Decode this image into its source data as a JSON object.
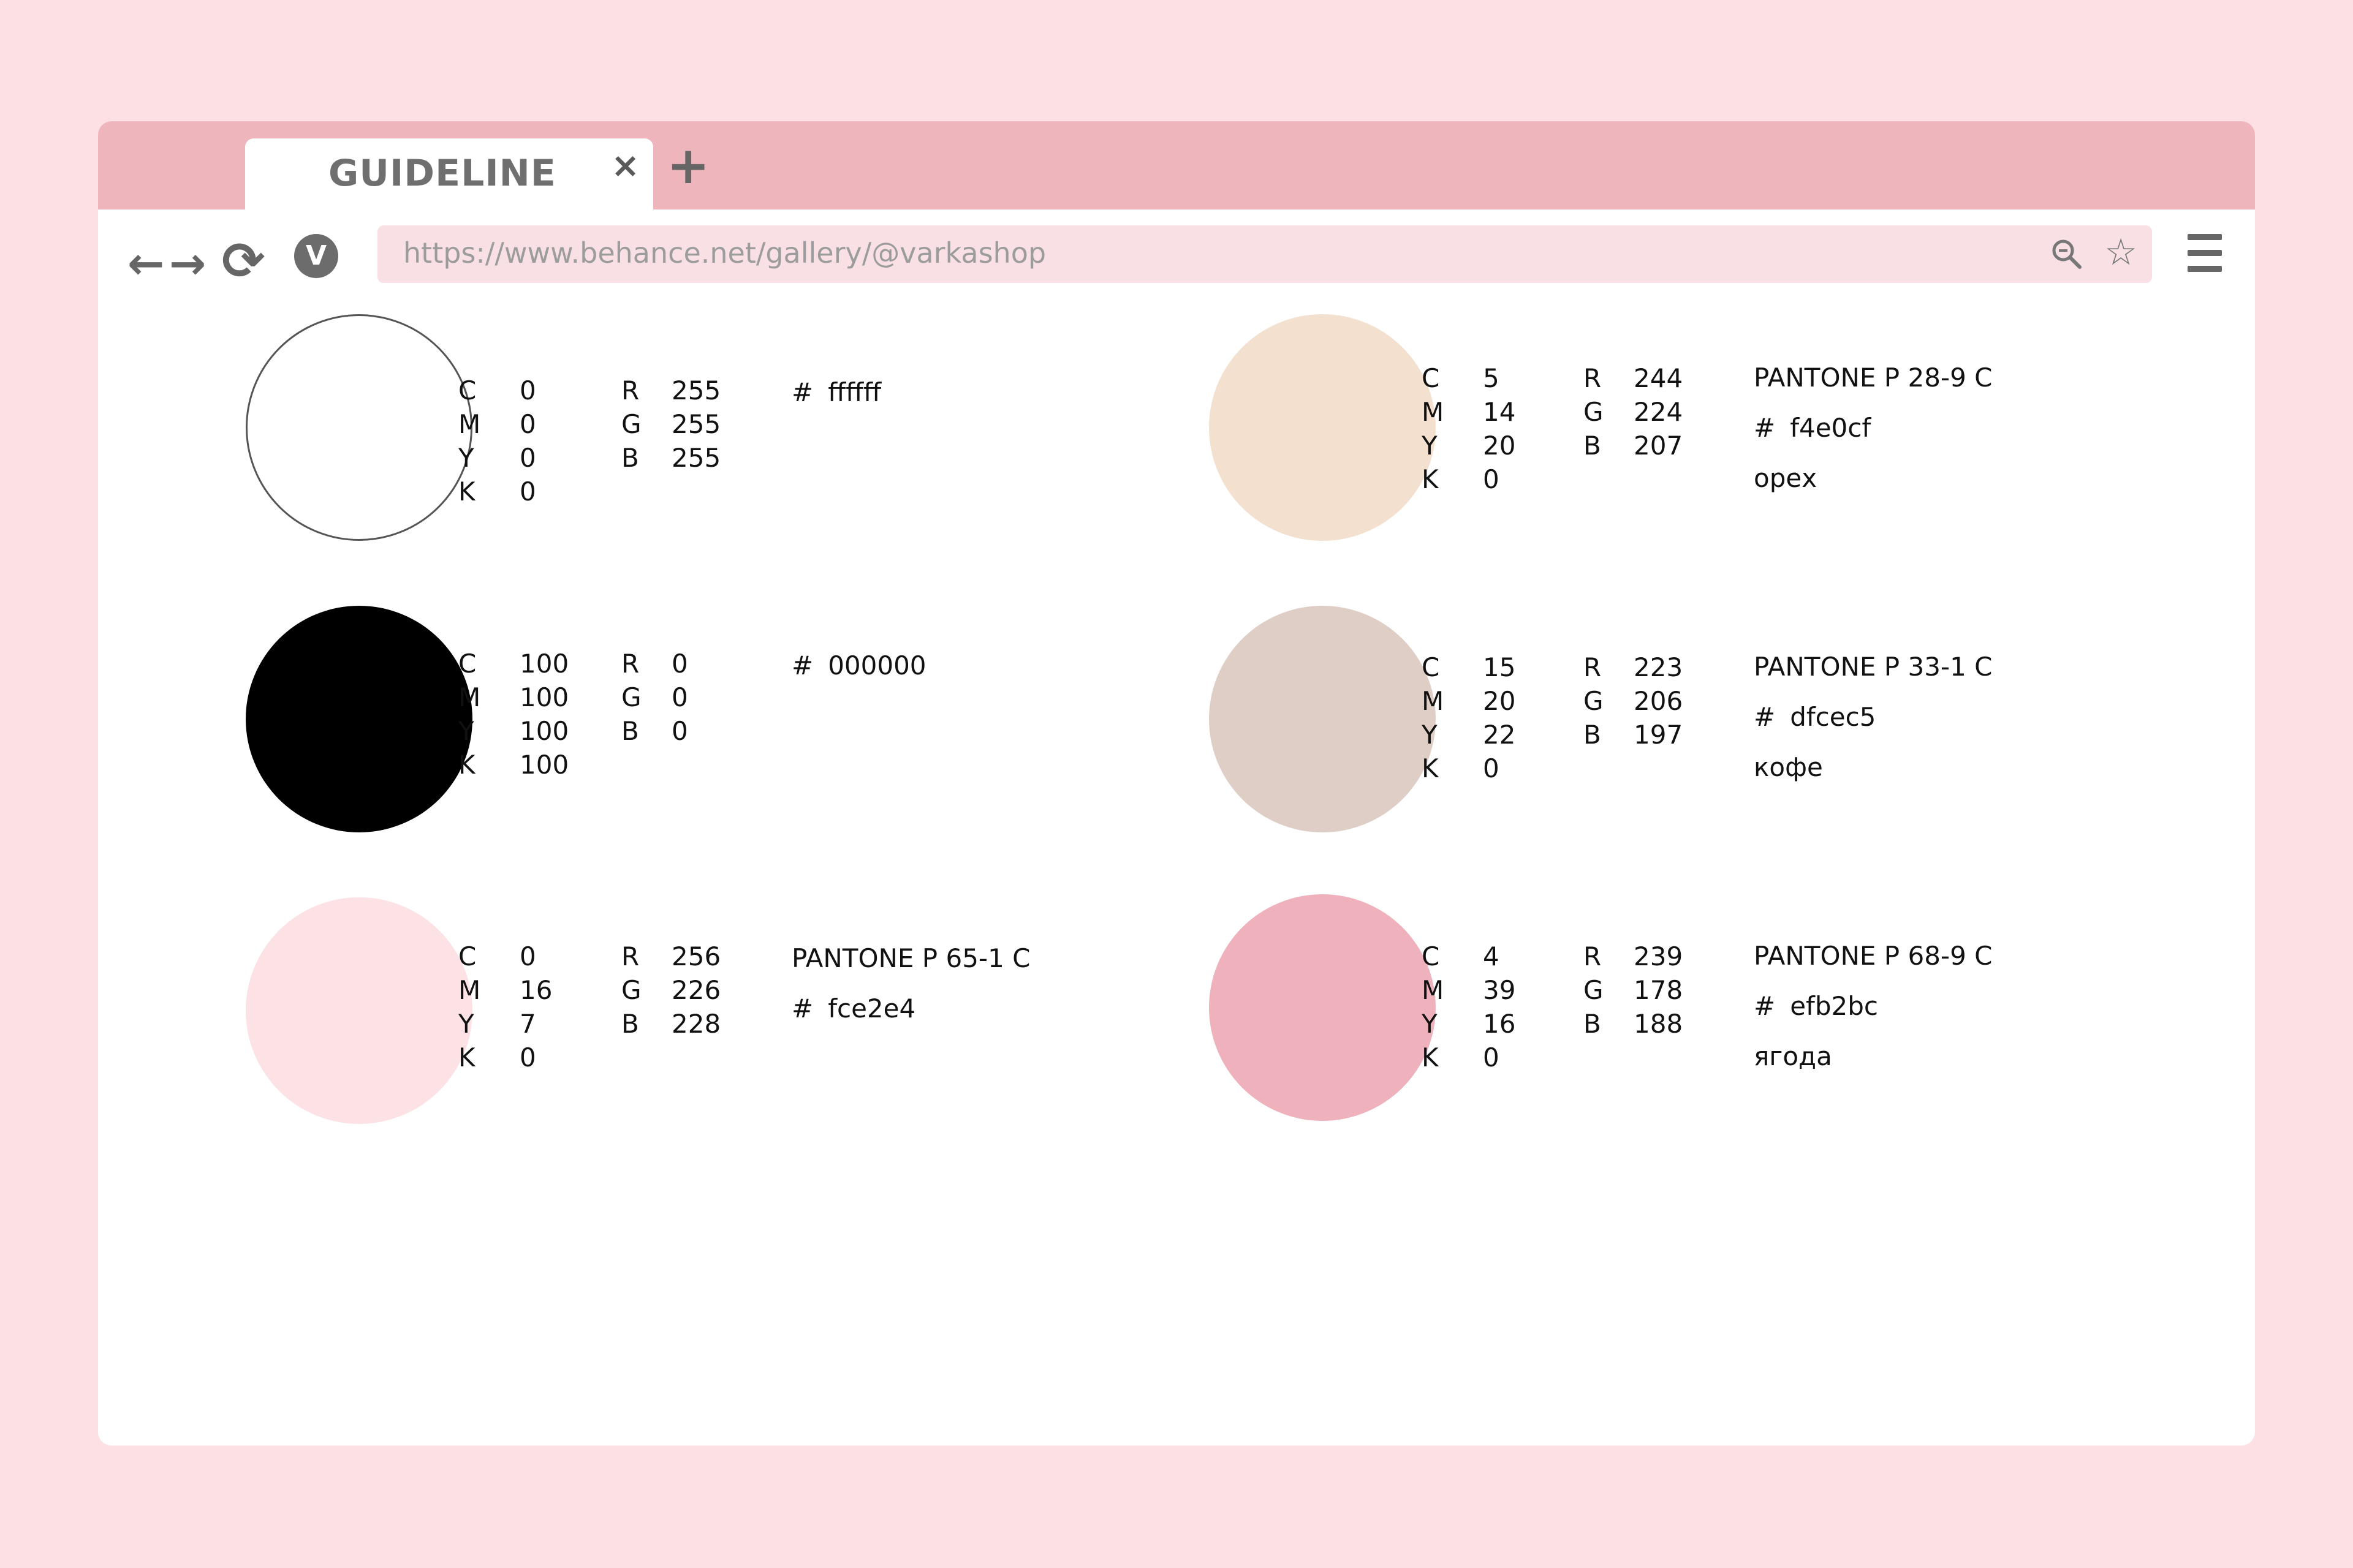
{
  "browser": {
    "tab_title": "GUIDELINE",
    "tab_close": "×",
    "tab_add": "+",
    "back": "←",
    "forward": "→",
    "reload": "⟳",
    "avatar_letter": "V",
    "url": "https://www.behance.net/gallery/@varkashop",
    "star": "☆",
    "icons": [
      "arrow-left-icon",
      "arrow-right-icon",
      "reload-icon",
      "search-icon",
      "star-icon",
      "hamburger-menu-icon"
    ]
  },
  "labels": {
    "c": "C",
    "m": "M",
    "y": "Y",
    "k": "K",
    "r": "R",
    "g": "G",
    "b": "B",
    "hash": "#"
  },
  "swatches": [
    {
      "fill": "#ffffff",
      "border": "#555555",
      "c": "0",
      "m": "0",
      "y": "0",
      "k": "0",
      "r": "255",
      "g": "255",
      "b": "255",
      "hex": "ffffff",
      "pantone": "",
      "name": ""
    },
    {
      "fill": "#000000",
      "c": "100",
      "m": "100",
      "y": "100",
      "k": "100",
      "r": "0",
      "g": "0",
      "b": "0",
      "hex": "000000",
      "pantone": "",
      "name": ""
    },
    {
      "fill": "#fce2e4",
      "c": "0",
      "m": "16",
      "y": "7",
      "k": "0",
      "r": "256",
      "g": "226",
      "b": "228",
      "hex": "fce2e4",
      "pantone": "PANTONE P 65-1 C",
      "name": ""
    },
    {
      "fill": "#f4e0cf",
      "c": "5",
      "m": "14",
      "y": "20",
      "k": "0",
      "r": "244",
      "g": "224",
      "b": "207",
      "hex": "f4e0cf",
      "pantone": "PANTONE P 28-9 C",
      "name": "орех"
    },
    {
      "fill": "#dfcec5",
      "c": "15",
      "m": "20",
      "y": "22",
      "k": "0",
      "r": "223",
      "g": "206",
      "b": "197",
      "hex": "dfcec5",
      "pantone": "PANTONE P 33-1 C",
      "name": "кофе"
    },
    {
      "fill": "#efb2bc",
      "c": "4",
      "m": "39",
      "y": "16",
      "k": "0",
      "r": "239",
      "g": "178",
      "b": "188",
      "hex": "efb2bc",
      "pantone": "PANTONE P 68-9 C",
      "name": "ягода"
    }
  ],
  "colors": {
    "page_bg": "#fde0e4",
    "tabbar": "#efb5bd",
    "url_bg": "#f8e0e4"
  }
}
